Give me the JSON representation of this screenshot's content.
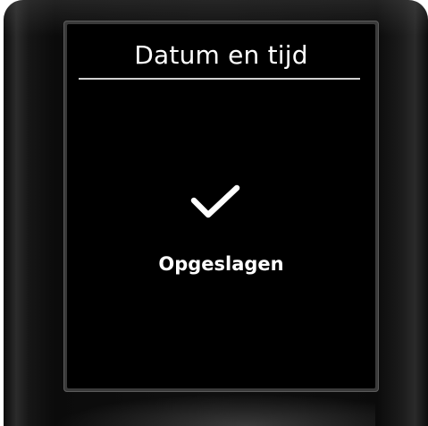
{
  "screen": {
    "title": "Datum en tijd",
    "status_icon": "checkmark-icon",
    "message": "Opgeslagen"
  },
  "colors": {
    "screen_background": "#000000",
    "text": "#ffffff",
    "divider": "#cfcfcf",
    "housing": "#0f0f0f"
  }
}
